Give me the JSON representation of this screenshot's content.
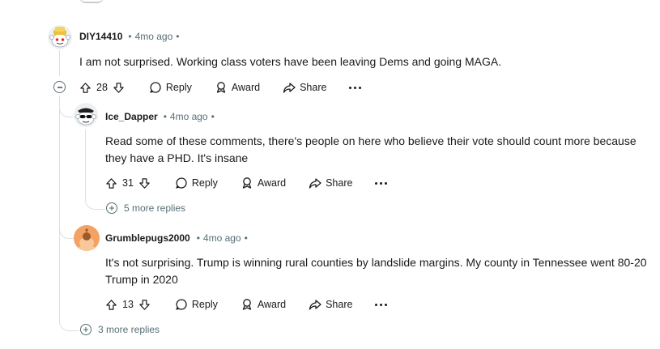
{
  "comments": [
    {
      "author": "DIY14410",
      "age": "4mo ago",
      "body": "I am not surprised. Working class voters have been leaving Dems and going MAGA.",
      "score": "28",
      "reply_label": "Reply",
      "award_label": "Award",
      "share_label": "Share"
    },
    {
      "author": "Ice_Dapper",
      "age": "4mo ago",
      "body_line1": "Read some of these comments, there's people on here who believe their vote should count more because",
      "body_line2": "they have a PHD. It's insane",
      "score": "31",
      "reply_label": "Reply",
      "award_label": "Award",
      "share_label": "Share",
      "more_replies": "5 more replies"
    },
    {
      "author": "Grumblepugs2000",
      "age": "4mo ago",
      "body_line1": "It's not surprising. Trump is winning rural counties by landslide margins. My county in Tennessee went 80-20",
      "body_line2": "Trump in 2020",
      "score": "13",
      "reply_label": "Reply",
      "award_label": "Award",
      "share_label": "Share"
    }
  ],
  "thread_more_replies": "3 more replies",
  "separator": "•",
  "icons": {
    "upvote": "upvote-icon",
    "downvote": "downvote-icon",
    "reply": "reply-icon",
    "award": "award-icon",
    "share": "share-icon",
    "more": "more-icon",
    "collapse": "collapse-icon",
    "expand": "expand-icon"
  }
}
